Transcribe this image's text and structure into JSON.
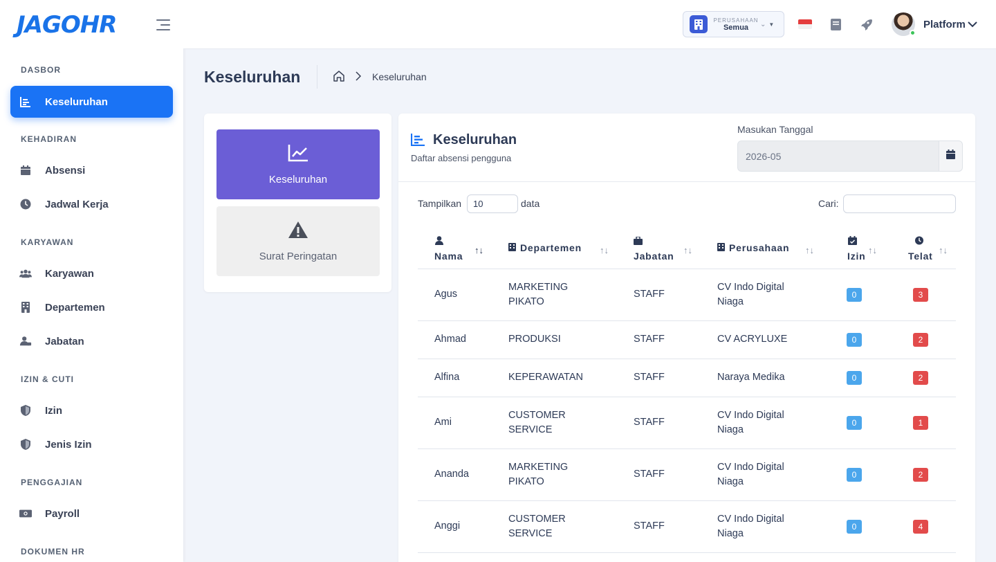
{
  "brand": {
    "logo_text": "JAGOHR"
  },
  "sidebar": {
    "sections": [
      {
        "label": "DASBOR"
      },
      {
        "label": "KEHADIRAN"
      },
      {
        "label": "KARYAWAN"
      },
      {
        "label": "IZIN & CUTI"
      },
      {
        "label": "PENGGAJIAN"
      },
      {
        "label": "DOKUMEN HR"
      }
    ],
    "items": [
      {
        "label": "Keseluruhan",
        "icon": "bar-chart-icon"
      },
      {
        "label": "Absensi",
        "icon": "calendar-icon"
      },
      {
        "label": "Jadwal Kerja",
        "icon": "clock-icon"
      },
      {
        "label": "Karyawan",
        "icon": "users-icon"
      },
      {
        "label": "Departemen",
        "icon": "building-icon"
      },
      {
        "label": "Jabatan",
        "icon": "user-tie-icon"
      },
      {
        "label": "Izin",
        "icon": "shield-icon"
      },
      {
        "label": "Jenis Izin",
        "icon": "shield-icon"
      },
      {
        "label": "Payroll",
        "icon": "money-icon"
      }
    ]
  },
  "topbar": {
    "company_caption": "PERUSAHAAN",
    "company_value": "Semua",
    "user_name": "Platform"
  },
  "page": {
    "title": "Keseluruhan",
    "breadcrumb_current": "Keseluruhan"
  },
  "tiles": [
    {
      "label": "Keseluruhan",
      "icon": "line-chart-icon",
      "active": true
    },
    {
      "label": "Surat Peringatan",
      "icon": "warning-icon",
      "active": false
    }
  ],
  "card": {
    "title": "Keseluruhan",
    "subtitle": "Daftar absensi pengguna",
    "date_label": "Masukan Tanggal",
    "date_value": "2026-05",
    "show_prefix": "Tampilkan",
    "show_value": "10",
    "show_suffix": "data",
    "search_label": "Cari:"
  },
  "table": {
    "headers": [
      "Nama",
      "Departemen",
      "Jabatan",
      "Perusahaan",
      "Izin",
      "Telat"
    ],
    "rows": [
      {
        "nama": "Agus",
        "dept1": "MARKETING",
        "dept2": "PIKATO",
        "jabatan": "STAFF",
        "pers1": "CV Indo Digital",
        "pers2": "Niaga",
        "izin": "0",
        "telat": "3"
      },
      {
        "nama": "Ahmad",
        "dept1": "PRODUKSI",
        "dept2": "",
        "jabatan": "STAFF",
        "pers1": "CV ACRYLUXE",
        "pers2": "",
        "izin": "0",
        "telat": "2"
      },
      {
        "nama": "Alfina",
        "dept1": "KEPERAWATAN",
        "dept2": "",
        "jabatan": "STAFF",
        "pers1": "Naraya Medika",
        "pers2": "",
        "izin": "0",
        "telat": "2"
      },
      {
        "nama": "Ami",
        "dept1": "CUSTOMER",
        "dept2": "SERVICE",
        "jabatan": "STAFF",
        "pers1": "CV Indo Digital",
        "pers2": "Niaga",
        "izin": "0",
        "telat": "1"
      },
      {
        "nama": "Ananda",
        "dept1": "MARKETING",
        "dept2": "PIKATO",
        "jabatan": "STAFF",
        "pers1": "CV Indo Digital",
        "pers2": "Niaga",
        "izin": "0",
        "telat": "2"
      },
      {
        "nama": "Anggi",
        "dept1": "CUSTOMER",
        "dept2": "SERVICE",
        "jabatan": "STAFF",
        "pers1": "CV Indo Digital",
        "pers2": "Niaga",
        "izin": "0",
        "telat": "4"
      }
    ]
  },
  "colors": {
    "accent": "#1a73f5",
    "tile_active": "#6b5ed6",
    "badge_izin": "#4ba6ec",
    "badge_telat": "#e24b4b"
  }
}
